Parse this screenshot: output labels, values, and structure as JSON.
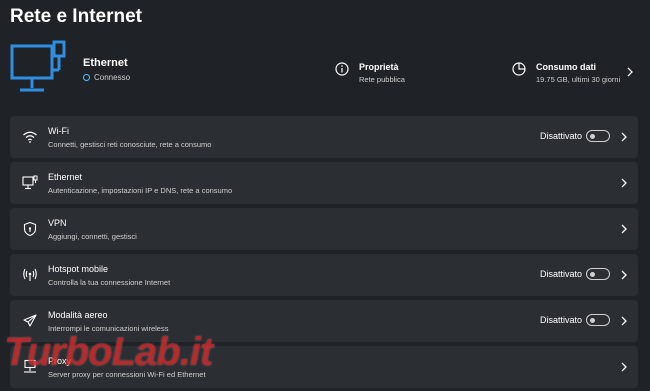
{
  "page": {
    "title": "Rete e Internet"
  },
  "header": {
    "connection_name": "Ethernet",
    "connection_status": "Connesso",
    "properties_label": "Proprietà",
    "properties_sub": "Rete pubblica",
    "usage_label": "Consumo dati",
    "usage_sub": "19.75 GB, ultimi 30 giorni"
  },
  "rows": [
    {
      "name": "Wi-Fi",
      "desc": "Connetti, gestisci reti conosciute, rete a consumo",
      "state": "Disattivato",
      "icon": "wifi-icon"
    },
    {
      "name": "Ethernet",
      "desc": "Autenticazione, impostazioni IP e DNS, rete a consumo",
      "icon": "ethernet-icon"
    },
    {
      "name": "VPN",
      "desc": "Aggiungi, connetti, gestisci",
      "icon": "vpn-shield-icon"
    },
    {
      "name": "Hotspot mobile",
      "desc": "Controlla la tua connessione Internet",
      "state": "Disattivato",
      "icon": "hotspot-icon"
    },
    {
      "name": "Modalità aereo",
      "desc": "Interrompi le comunicazioni wireless",
      "state": "Disattivato",
      "icon": "airplane-icon"
    },
    {
      "name": "Proxy",
      "desc": "Server proxy per connessioni Wi-Fi ed Ethernet",
      "icon": "proxy-icon"
    }
  ],
  "watermark": "TurboLab.it",
  "colors": {
    "accent": "#4cc2ff",
    "monitor_blue": "#2f8ee0",
    "background": "#1f2227",
    "row": "#2b2e33"
  }
}
